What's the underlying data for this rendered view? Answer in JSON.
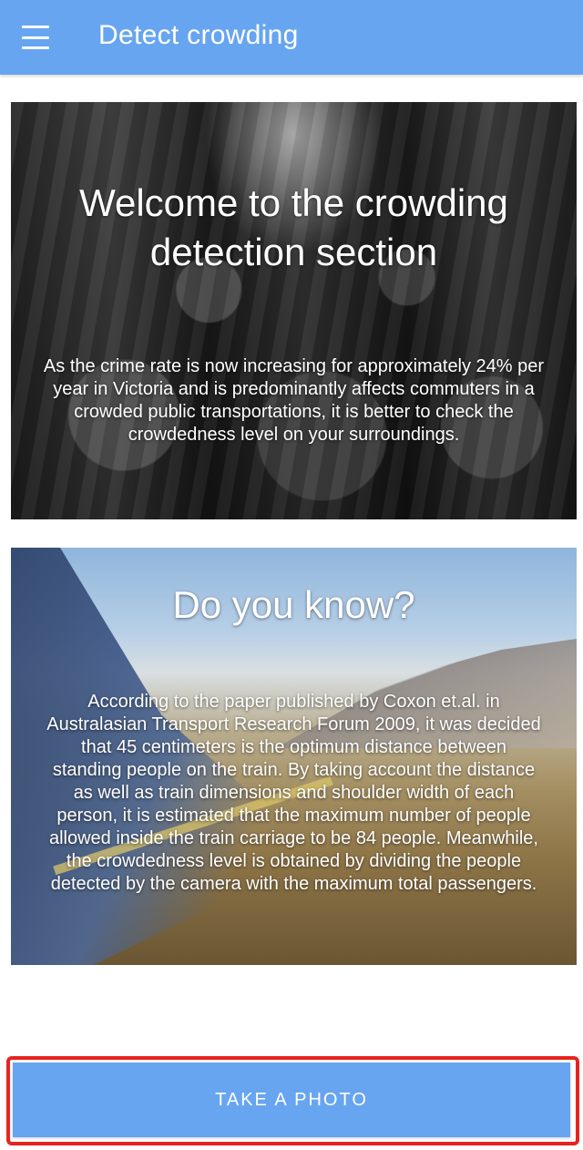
{
  "app_bar": {
    "title": "Detect crowding",
    "menu_icon": "hamburger-menu-icon",
    "background": "#67a5f0"
  },
  "cards": [
    {
      "title": "Welcome to the crowding detection section",
      "text": "As the crime rate is now increasing for approximately 24% per year in Victoria and is predominantly affects commuters in a crowded public transportations, it is better to check the crowdedness level on your surroundings."
    },
    {
      "title": "Do you know?",
      "text": "According to the paper published by Coxon et.al. in Australasian Transport Research Forum 2009, it was decided that 45 centimeters is the optimum distance between standing people on the train. By taking account the distance as well as train dimensions and shoulder width of each person, it is estimated that the maximum number of people allowed inside the train carriage to be 84 people. Meanwhile, the crowdedness level is obtained by dividing the people detected by the camera with the maximum total passengers."
    }
  ],
  "actions": {
    "take_photo_label": "TAKE A PHOTO",
    "button_color": "#67a5f0",
    "highlight_color": "#e8231f"
  }
}
